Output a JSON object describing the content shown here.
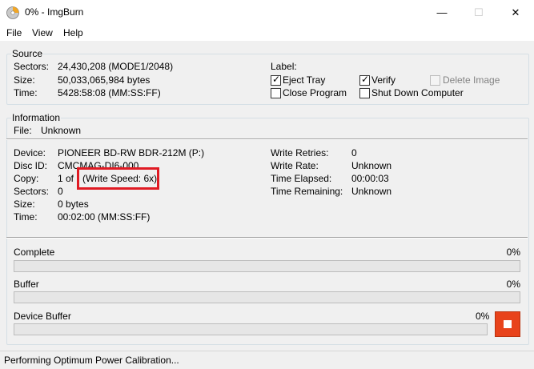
{
  "window": {
    "title": "0% - ImgBurn",
    "minimize": "—",
    "maximize": "☐",
    "close": "✕"
  },
  "menu": [
    "File",
    "View",
    "Help"
  ],
  "source": {
    "title": "Source",
    "sectors_label": "Sectors:",
    "sectors_value": "24,430,208 (MODE1/2048)",
    "size_label": "Size:",
    "size_value": "50,033,065,984 bytes",
    "time_label": "Time:",
    "time_value": "5428:58:08 (MM:SS:FF)",
    "label_label": "Label:",
    "options": {
      "eject_tray": {
        "label": "Eject Tray",
        "checked": true
      },
      "verify": {
        "label": "Verify",
        "checked": true
      },
      "delete_image": {
        "label": "Delete Image",
        "checked": false,
        "enabled": false
      },
      "close_program": {
        "label": "Close Program",
        "checked": false
      },
      "shut_down": {
        "label": "Shut Down Computer",
        "checked": false
      }
    }
  },
  "information": {
    "title": "Information",
    "file_label": "File:",
    "file_value": "Unknown",
    "device_label": "Device:",
    "device_value": "PIONEER BD-RW BDR-212M (P:)",
    "disc_id_label": "Disc ID:",
    "disc_id_value": "CMCMAG-DI6-000",
    "copy_label": "Copy:",
    "copy_value": "1 of",
    "write_speed": "(Write Speed: 6x)",
    "sectors_label": "Sectors:",
    "sectors_value": "0",
    "size_label": "Size:",
    "size_value": "0 bytes",
    "time_label": "Time:",
    "time_value": "00:02:00 (MM:SS:FF)",
    "write_retries_label": "Write Retries:",
    "write_retries_value": "0",
    "write_rate_label": "Write Rate:",
    "write_rate_value": "Unknown",
    "time_elapsed_label": "Time Elapsed:",
    "time_elapsed_value": "00:00:03",
    "time_remaining_label": "Time Remaining:",
    "time_remaining_value": "Unknown"
  },
  "progress": {
    "complete_label": "Complete",
    "complete_percent": "0%",
    "complete_value": 0,
    "buffer_label": "Buffer",
    "buffer_percent": "0%",
    "buffer_value": 0,
    "device_buffer_label": "Device Buffer",
    "device_buffer_percent": "0%",
    "device_buffer_value": 0
  },
  "status": "Performing Optimum Power Calibration...",
  "colors": {
    "highlight": "#e01b24",
    "stop_button": "#e8431b",
    "progress_fill": "#06b025"
  }
}
